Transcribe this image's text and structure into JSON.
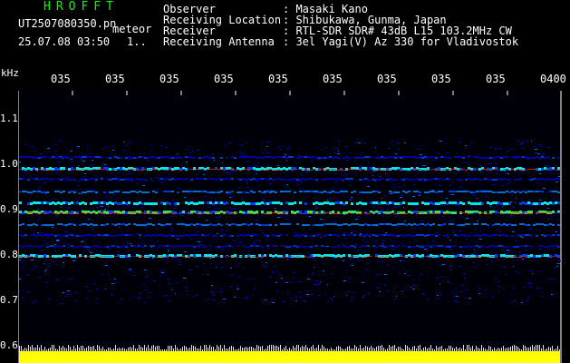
{
  "header": {
    "title": "HROFFT",
    "filename": "UT2507080350.pn",
    "meteor_label": "meteor",
    "datetime": "25.07.08 03:50",
    "count": "1.."
  },
  "metadata": [
    {
      "label": "Observer",
      "value": ": Masaki Kano"
    },
    {
      "label": "Receiving Location",
      "value": ": Shibukawa, Gunma, Japan"
    },
    {
      "label": "Receiver",
      "value": ": RTL-SDR SDR# 43dB L15 103.2MHz CW"
    },
    {
      "label": "Receiving Antenna",
      "value": ": 3el Yagi(V) Az 330 for Vladivostok"
    }
  ],
  "axes": {
    "y_unit": "kHz",
    "y_ticks": [
      "1.1",
      "1.0",
      "0.9",
      "0.8",
      "0.7",
      "0.6"
    ],
    "x_ticks": [
      "035",
      "035",
      "035",
      "035",
      "035",
      "035",
      "035",
      "035",
      "035",
      "0400"
    ]
  },
  "colors": {
    "background": "#000000",
    "noise_low": "#0000cc",
    "noise_mid": "#00ffff",
    "signal": "#ff3300",
    "level_bar": "#ffff00"
  }
}
